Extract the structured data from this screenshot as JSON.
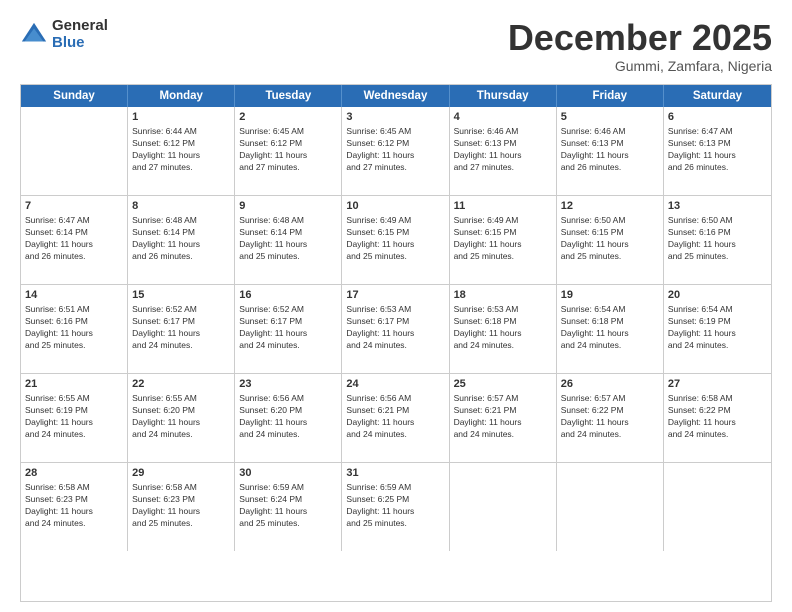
{
  "logo": {
    "general": "General",
    "blue": "Blue"
  },
  "header": {
    "month": "December 2025",
    "location": "Gummi, Zamfara, Nigeria"
  },
  "weekdays": [
    "Sunday",
    "Monday",
    "Tuesday",
    "Wednesday",
    "Thursday",
    "Friday",
    "Saturday"
  ],
  "rows": [
    [
      {
        "day": "",
        "sunrise": "",
        "sunset": "",
        "daylight": ""
      },
      {
        "day": "1",
        "sunrise": "Sunrise: 6:44 AM",
        "sunset": "Sunset: 6:12 PM",
        "daylight": "Daylight: 11 hours and 27 minutes."
      },
      {
        "day": "2",
        "sunrise": "Sunrise: 6:45 AM",
        "sunset": "Sunset: 6:12 PM",
        "daylight": "Daylight: 11 hours and 27 minutes."
      },
      {
        "day": "3",
        "sunrise": "Sunrise: 6:45 AM",
        "sunset": "Sunset: 6:12 PM",
        "daylight": "Daylight: 11 hours and 27 minutes."
      },
      {
        "day": "4",
        "sunrise": "Sunrise: 6:46 AM",
        "sunset": "Sunset: 6:13 PM",
        "daylight": "Daylight: 11 hours and 27 minutes."
      },
      {
        "day": "5",
        "sunrise": "Sunrise: 6:46 AM",
        "sunset": "Sunset: 6:13 PM",
        "daylight": "Daylight: 11 hours and 26 minutes."
      },
      {
        "day": "6",
        "sunrise": "Sunrise: 6:47 AM",
        "sunset": "Sunset: 6:13 PM",
        "daylight": "Daylight: 11 hours and 26 minutes."
      }
    ],
    [
      {
        "day": "7",
        "sunrise": "Sunrise: 6:47 AM",
        "sunset": "Sunset: 6:14 PM",
        "daylight": "Daylight: 11 hours and 26 minutes."
      },
      {
        "day": "8",
        "sunrise": "Sunrise: 6:48 AM",
        "sunset": "Sunset: 6:14 PM",
        "daylight": "Daylight: 11 hours and 26 minutes."
      },
      {
        "day": "9",
        "sunrise": "Sunrise: 6:48 AM",
        "sunset": "Sunset: 6:14 PM",
        "daylight": "Daylight: 11 hours and 25 minutes."
      },
      {
        "day": "10",
        "sunrise": "Sunrise: 6:49 AM",
        "sunset": "Sunset: 6:15 PM",
        "daylight": "Daylight: 11 hours and 25 minutes."
      },
      {
        "day": "11",
        "sunrise": "Sunrise: 6:49 AM",
        "sunset": "Sunset: 6:15 PM",
        "daylight": "Daylight: 11 hours and 25 minutes."
      },
      {
        "day": "12",
        "sunrise": "Sunrise: 6:50 AM",
        "sunset": "Sunset: 6:15 PM",
        "daylight": "Daylight: 11 hours and 25 minutes."
      },
      {
        "day": "13",
        "sunrise": "Sunrise: 6:50 AM",
        "sunset": "Sunset: 6:16 PM",
        "daylight": "Daylight: 11 hours and 25 minutes."
      }
    ],
    [
      {
        "day": "14",
        "sunrise": "Sunrise: 6:51 AM",
        "sunset": "Sunset: 6:16 PM",
        "daylight": "Daylight: 11 hours and 25 minutes."
      },
      {
        "day": "15",
        "sunrise": "Sunrise: 6:52 AM",
        "sunset": "Sunset: 6:17 PM",
        "daylight": "Daylight: 11 hours and 24 minutes."
      },
      {
        "day": "16",
        "sunrise": "Sunrise: 6:52 AM",
        "sunset": "Sunset: 6:17 PM",
        "daylight": "Daylight: 11 hours and 24 minutes."
      },
      {
        "day": "17",
        "sunrise": "Sunrise: 6:53 AM",
        "sunset": "Sunset: 6:17 PM",
        "daylight": "Daylight: 11 hours and 24 minutes."
      },
      {
        "day": "18",
        "sunrise": "Sunrise: 6:53 AM",
        "sunset": "Sunset: 6:18 PM",
        "daylight": "Daylight: 11 hours and 24 minutes."
      },
      {
        "day": "19",
        "sunrise": "Sunrise: 6:54 AM",
        "sunset": "Sunset: 6:18 PM",
        "daylight": "Daylight: 11 hours and 24 minutes."
      },
      {
        "day": "20",
        "sunrise": "Sunrise: 6:54 AM",
        "sunset": "Sunset: 6:19 PM",
        "daylight": "Daylight: 11 hours and 24 minutes."
      }
    ],
    [
      {
        "day": "21",
        "sunrise": "Sunrise: 6:55 AM",
        "sunset": "Sunset: 6:19 PM",
        "daylight": "Daylight: 11 hours and 24 minutes."
      },
      {
        "day": "22",
        "sunrise": "Sunrise: 6:55 AM",
        "sunset": "Sunset: 6:20 PM",
        "daylight": "Daylight: 11 hours and 24 minutes."
      },
      {
        "day": "23",
        "sunrise": "Sunrise: 6:56 AM",
        "sunset": "Sunset: 6:20 PM",
        "daylight": "Daylight: 11 hours and 24 minutes."
      },
      {
        "day": "24",
        "sunrise": "Sunrise: 6:56 AM",
        "sunset": "Sunset: 6:21 PM",
        "daylight": "Daylight: 11 hours and 24 minutes."
      },
      {
        "day": "25",
        "sunrise": "Sunrise: 6:57 AM",
        "sunset": "Sunset: 6:21 PM",
        "daylight": "Daylight: 11 hours and 24 minutes."
      },
      {
        "day": "26",
        "sunrise": "Sunrise: 6:57 AM",
        "sunset": "Sunset: 6:22 PM",
        "daylight": "Daylight: 11 hours and 24 minutes."
      },
      {
        "day": "27",
        "sunrise": "Sunrise: 6:58 AM",
        "sunset": "Sunset: 6:22 PM",
        "daylight": "Daylight: 11 hours and 24 minutes."
      }
    ],
    [
      {
        "day": "28",
        "sunrise": "Sunrise: 6:58 AM",
        "sunset": "Sunset: 6:23 PM",
        "daylight": "Daylight: 11 hours and 24 minutes."
      },
      {
        "day": "29",
        "sunrise": "Sunrise: 6:58 AM",
        "sunset": "Sunset: 6:23 PM",
        "daylight": "Daylight: 11 hours and 25 minutes."
      },
      {
        "day": "30",
        "sunrise": "Sunrise: 6:59 AM",
        "sunset": "Sunset: 6:24 PM",
        "daylight": "Daylight: 11 hours and 25 minutes."
      },
      {
        "day": "31",
        "sunrise": "Sunrise: 6:59 AM",
        "sunset": "Sunset: 6:25 PM",
        "daylight": "Daylight: 11 hours and 25 minutes."
      },
      {
        "day": "",
        "sunrise": "",
        "sunset": "",
        "daylight": ""
      },
      {
        "day": "",
        "sunrise": "",
        "sunset": "",
        "daylight": ""
      },
      {
        "day": "",
        "sunrise": "",
        "sunset": "",
        "daylight": ""
      }
    ]
  ]
}
